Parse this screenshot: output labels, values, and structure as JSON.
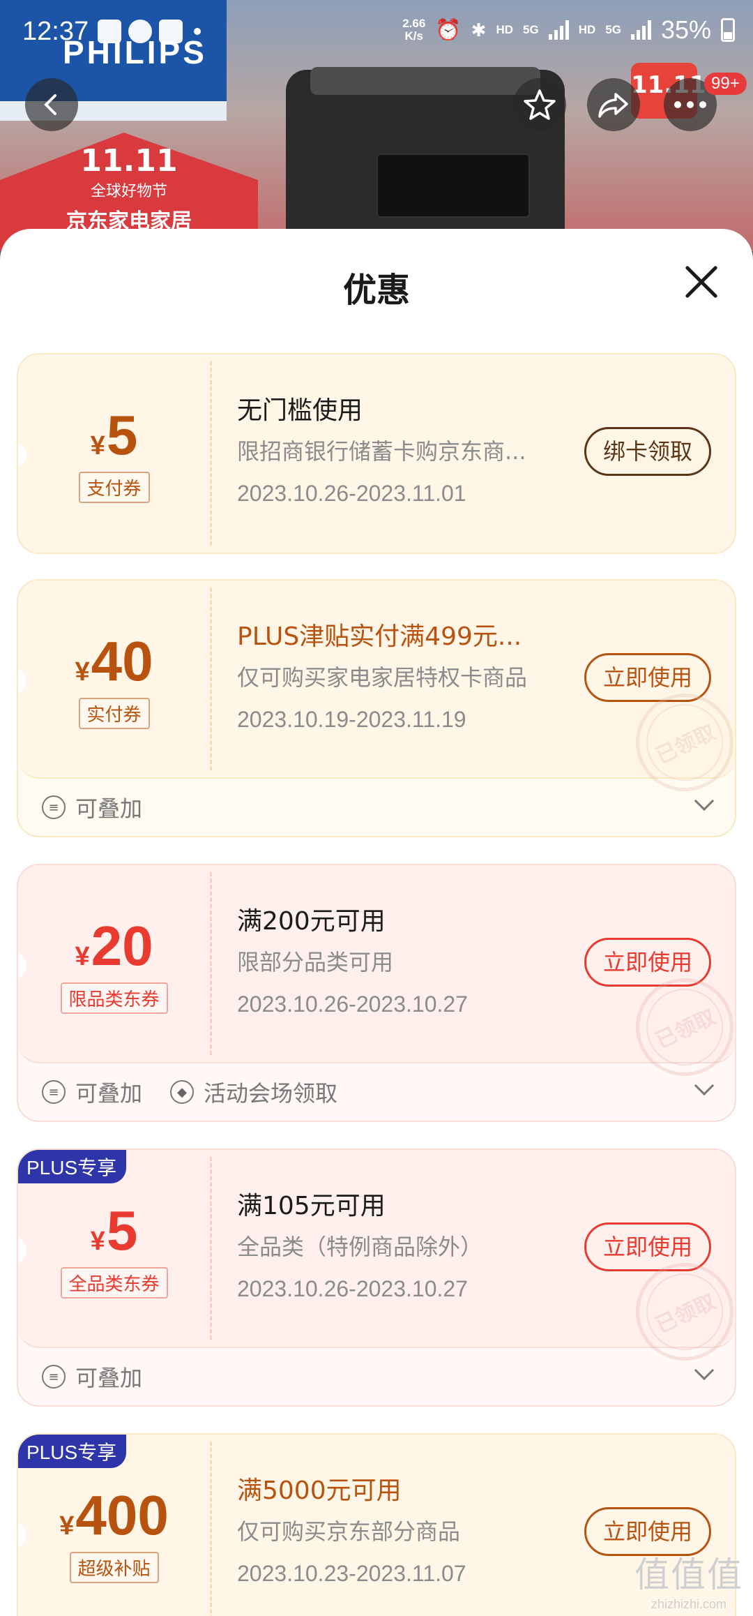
{
  "status_bar": {
    "time": "12:37",
    "net_speed_value": "2.66",
    "net_speed_unit": "K/s",
    "hd1": "HD",
    "net1": "5G",
    "hd2": "HD",
    "net2": "5G",
    "battery": "35%"
  },
  "background": {
    "brand_logo": "PHILIPS",
    "promo_line1": "11.11",
    "promo_line2": "全球好物节",
    "promo_line3": "京东家电家居",
    "badge_text": "11.11"
  },
  "nav": {
    "back_icon": "arrow-left-icon",
    "favorite_icon": "star-icon",
    "share_icon": "share-icon",
    "more_icon": "more-icon",
    "message_badge": "99+"
  },
  "sheet": {
    "title": "优惠",
    "close_icon": "close-icon"
  },
  "coupons": [
    {
      "style": "gold",
      "currency": "¥",
      "amount": "5",
      "tag": "支付券",
      "title": "无门槛使用",
      "description": "限招商银行储蓄卡购京东商...",
      "date_range": "2023.10.26-2023.11.01",
      "action": "绑卡领取"
    },
    {
      "style": "gold",
      "currency": "¥",
      "amount": "40",
      "tag": "实付券",
      "title": "PLUS津贴实付满499元...",
      "description": "仅可购买家电家居特权卡商品",
      "date_range": "2023.10.19-2023.11.19",
      "action": "立即使用",
      "stamp": "已领取",
      "footer": [
        "可叠加"
      ]
    },
    {
      "style": "red",
      "currency": "¥",
      "amount": "20",
      "tag": "限品类东券",
      "title": "满200元可用",
      "description": "限部分品类可用",
      "date_range": "2023.10.26-2023.10.27",
      "action": "立即使用",
      "stamp": "已领取",
      "footer": [
        "可叠加",
        "活动会场领取"
      ]
    },
    {
      "style": "red",
      "badge": "PLUS专享",
      "currency": "¥",
      "amount": "5",
      "tag": "全品类东券",
      "title": "满105元可用",
      "description": "全品类（特例商品除外）",
      "date_range": "2023.10.26-2023.10.27",
      "action": "立即使用",
      "stamp": "已领取",
      "footer": [
        "可叠加"
      ]
    },
    {
      "style": "gold",
      "badge": "PLUS专享",
      "currency": "¥",
      "amount": "400",
      "tag": "超级补贴",
      "title": "满5000元可用",
      "description": "仅可购买京东部分商品",
      "date_range": "2023.10.23-2023.11.07",
      "action": "立即使用"
    }
  ],
  "watermark": {
    "main": "值值值",
    "sub": "zhizhizhi.com"
  },
  "colors": {
    "gold_accent": "#b8530f",
    "red_accent": "#e83a2f",
    "plus_badge": "#2d35a8"
  }
}
